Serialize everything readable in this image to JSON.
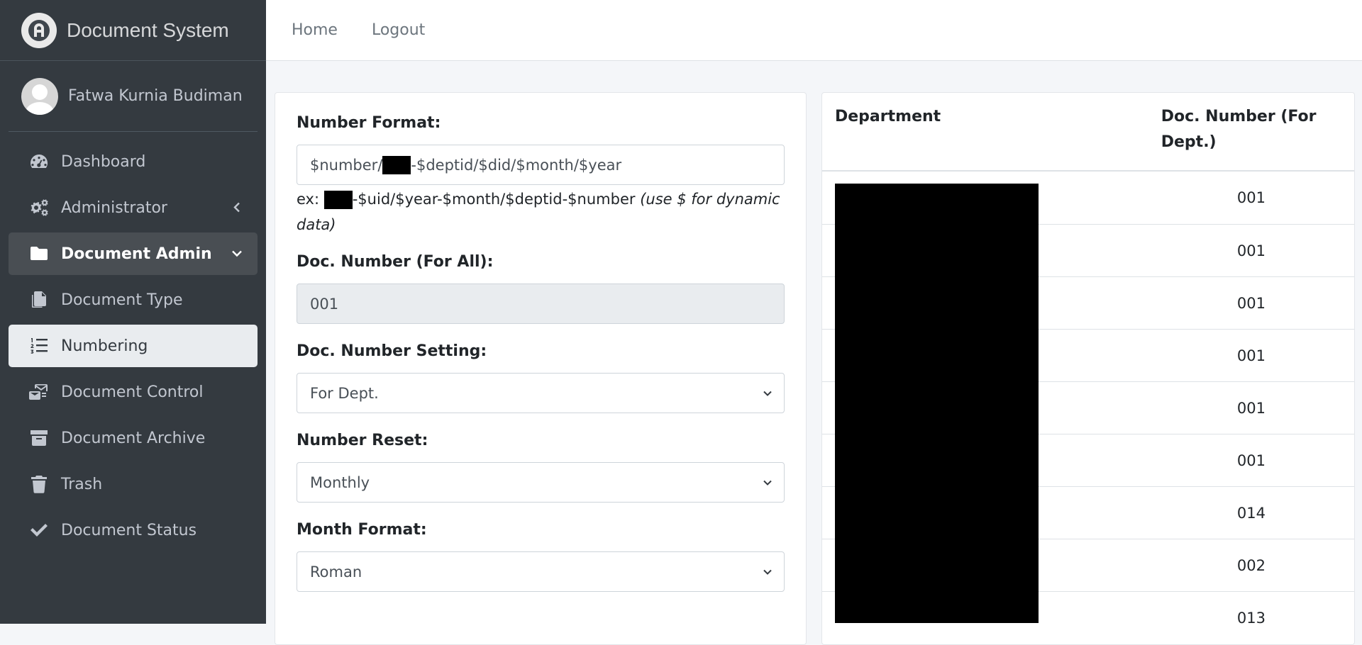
{
  "brand": {
    "name": "Document System"
  },
  "user": {
    "name": "Fatwa Kurnia Budiman"
  },
  "sidebar": {
    "items": [
      {
        "label": "Dashboard",
        "icon": "dashboard-icon"
      },
      {
        "label": "Administrator",
        "icon": "cogs-icon"
      },
      {
        "label": "Document Admin",
        "icon": "folder-icon"
      },
      {
        "label": "Document Type",
        "icon": "copy-icon"
      },
      {
        "label": "Numbering",
        "icon": "list-ol-icon"
      },
      {
        "label": "Document Control",
        "icon": "mail-bulk-icon"
      },
      {
        "label": "Document Archive",
        "icon": "archive-icon"
      },
      {
        "label": "Trash",
        "icon": "trash-icon"
      },
      {
        "label": "Document Status",
        "icon": "check-icon"
      }
    ]
  },
  "topnav": {
    "home": "Home",
    "logout": "Logout"
  },
  "form": {
    "number_format": {
      "label": "Number Format:",
      "value_before": "$number/",
      "value_after": "-$deptid/$did/$month/$year",
      "help_prefix": "ex: ",
      "help_example": "-$uid/$year-$month/$deptid-$number",
      "help_note": "(use $ for dynamic data)"
    },
    "doc_number_all": {
      "label": "Doc. Number (For All):",
      "value": "001"
    },
    "doc_number_setting": {
      "label": "Doc. Number Setting:",
      "value": "For Dept."
    },
    "number_reset": {
      "label": "Number Reset:",
      "value": "Monthly"
    },
    "month_format": {
      "label": "Month Format:",
      "value": "Roman"
    }
  },
  "table": {
    "headers": {
      "department": "Department",
      "doc_number": "Doc. Number (For Dept.)"
    },
    "rows": [
      "001",
      "001",
      "001",
      "001",
      "001",
      "001",
      "014",
      "002",
      "013"
    ]
  },
  "colors": {
    "sidebar_bg": "#343a40",
    "active_bg": "#e9ecef",
    "open_bg": "#494e53"
  }
}
